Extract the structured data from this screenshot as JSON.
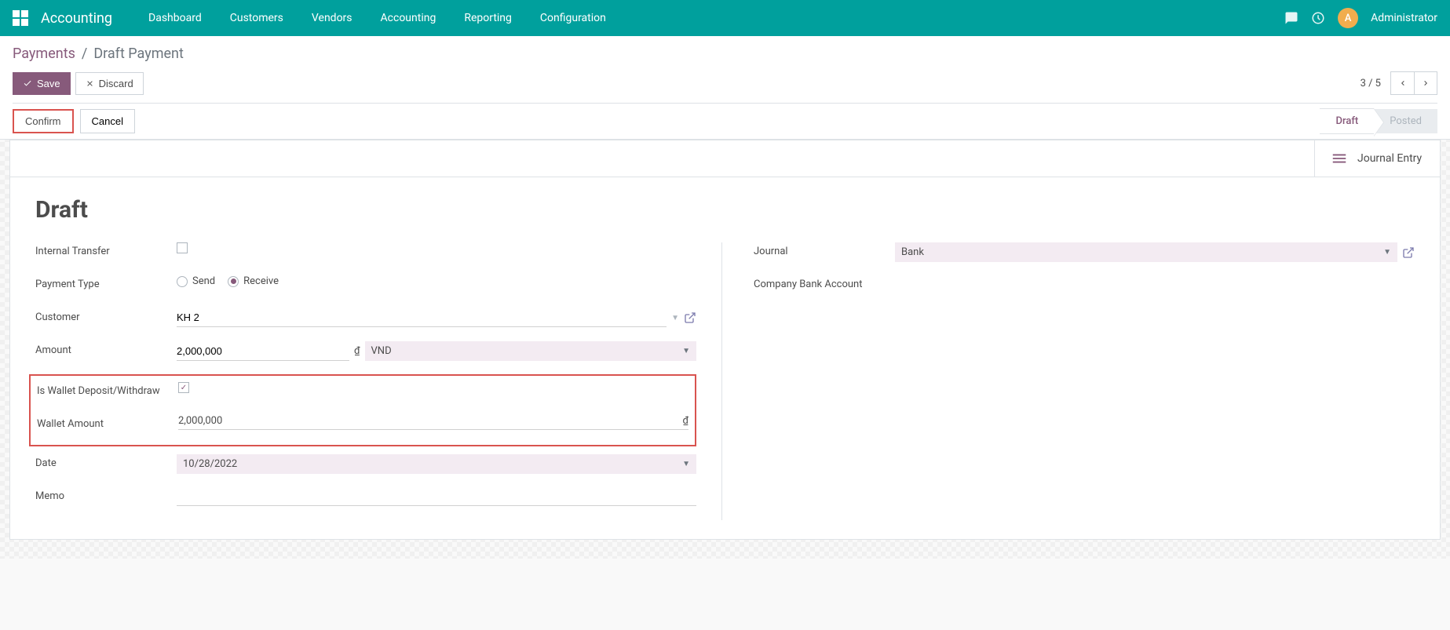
{
  "navbar": {
    "brand": "Accounting",
    "links": [
      "Dashboard",
      "Customers",
      "Vendors",
      "Accounting",
      "Reporting",
      "Configuration"
    ],
    "user_initial": "A",
    "username": "Administrator"
  },
  "breadcrumb": {
    "parent": "Payments",
    "current": "Draft Payment"
  },
  "buttons": {
    "save": "Save",
    "discard": "Discard",
    "confirm": "Confirm",
    "cancel": "Cancel"
  },
  "pager": {
    "text": "3 / 5"
  },
  "status": {
    "draft": "Draft",
    "posted": "Posted"
  },
  "stat_button": {
    "label": "Journal Entry"
  },
  "form": {
    "title": "Draft",
    "labels": {
      "internal_transfer": "Internal Transfer",
      "payment_type": "Payment Type",
      "customer": "Customer",
      "amount": "Amount",
      "is_wallet": "Is Wallet Deposit/Withdraw",
      "wallet_amount": "Wallet Amount",
      "date": "Date",
      "memo": "Memo",
      "journal": "Journal",
      "company_bank": "Company Bank Account"
    },
    "values": {
      "internal_transfer": false,
      "payment_type_send": "Send",
      "payment_type_receive": "Receive",
      "payment_type_selected": "receive",
      "customer": "KH 2",
      "amount": "2,000,000",
      "currency_symbol": "₫",
      "currency": "VND",
      "is_wallet": true,
      "wallet_amount": "2,000,000",
      "date": "10/28/2022",
      "memo": "",
      "journal": "Bank",
      "company_bank": ""
    }
  }
}
